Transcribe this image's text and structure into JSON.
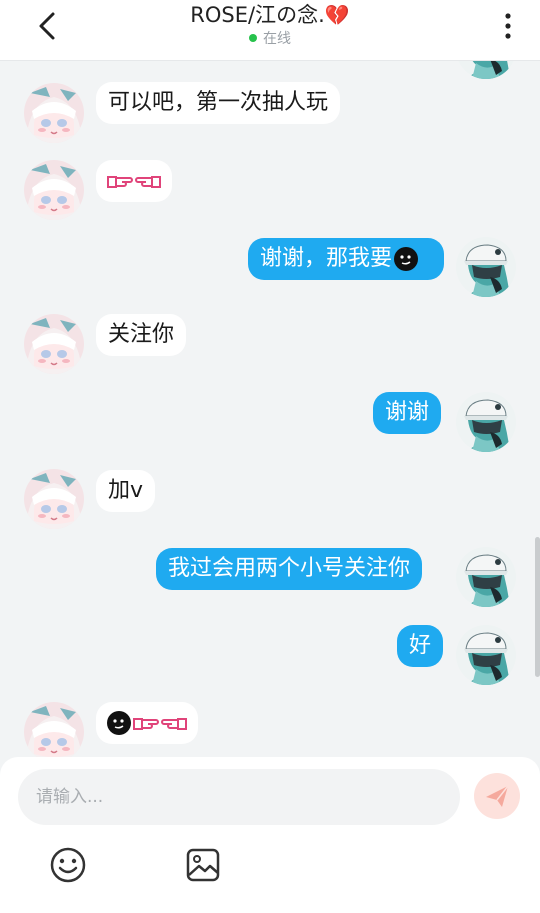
{
  "header": {
    "title": "ROSE/江の念.",
    "title_emoji": "💔",
    "status": "在线"
  },
  "messages": [
    {
      "side": "other",
      "text": "可以吧，第一次抽人玩"
    },
    {
      "side": "other",
      "text": "",
      "emojis": [
        "point-right-emoji",
        "point-left-emoji"
      ]
    },
    {
      "side": "self",
      "text": "谢谢，那我要",
      "emojis": [
        "dark-face-emoji"
      ]
    },
    {
      "side": "other",
      "text": "关注你"
    },
    {
      "side": "self",
      "text": "谢谢"
    },
    {
      "side": "other",
      "text": "加v"
    },
    {
      "side": "self",
      "text": "我过会用两个小号关注你"
    },
    {
      "side": "self",
      "text": "好"
    },
    {
      "side": "other",
      "text": "",
      "emojis": [
        "dark-face-emoji",
        "point-right-emoji",
        "point-left-emoji"
      ]
    }
  ],
  "composer": {
    "placeholder": "请输入..."
  },
  "icons": {
    "back": "chevron-left-icon",
    "more": "more-vertical-icon",
    "send": "send-icon",
    "emoji": "smiley-icon",
    "image": "image-icon"
  },
  "colors": {
    "self_bubble": "#1faaf0",
    "other_bubble": "#ffffff",
    "background": "#f2f4f5",
    "online": "#27c24c",
    "send_button": "#fde1dc"
  }
}
